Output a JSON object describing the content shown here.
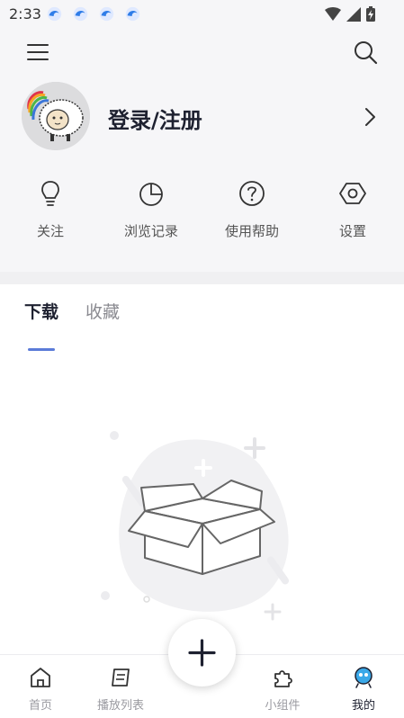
{
  "status_bar": {
    "time": "2:33",
    "notification_icons": [
      "wave-notification-icon",
      "wave-notification-icon",
      "wave-notification-icon",
      "wave-notification-icon"
    ],
    "right_icons": [
      "wifi-icon",
      "signal-icon",
      "battery-charging-icon"
    ]
  },
  "header": {
    "menu_icon": "hamburger-menu-icon",
    "search_icon": "search-icon"
  },
  "profile": {
    "login_label": "登录/注册",
    "arrow_icon": "chevron-right-icon"
  },
  "quick_actions": [
    {
      "label": "关注",
      "icon": "lightbulb-icon"
    },
    {
      "label": "浏览记录",
      "icon": "pie-chart-icon"
    },
    {
      "label": "使用帮助",
      "icon": "help-icon"
    },
    {
      "label": "设置",
      "icon": "settings-icon"
    }
  ],
  "tabs": [
    {
      "label": "下载",
      "active": true
    },
    {
      "label": "收藏",
      "active": false
    }
  ],
  "empty_state": {
    "icon": "empty-box-icon"
  },
  "bottom_nav": [
    {
      "label": "首页",
      "icon": "home-icon",
      "active": false
    },
    {
      "label": "播放列表",
      "icon": "playlist-icon",
      "active": false
    },
    {
      "label": "小组件",
      "icon": "puzzle-icon",
      "active": false
    },
    {
      "label": "我的",
      "icon": "mascot-icon",
      "active": true
    }
  ],
  "fab": {
    "icon": "plus-icon"
  },
  "colors": {
    "accent": "#5b7bd8",
    "header_bg": "#f6f6f8",
    "text_primary": "#1e2130",
    "text_secondary": "#8a8a90"
  }
}
